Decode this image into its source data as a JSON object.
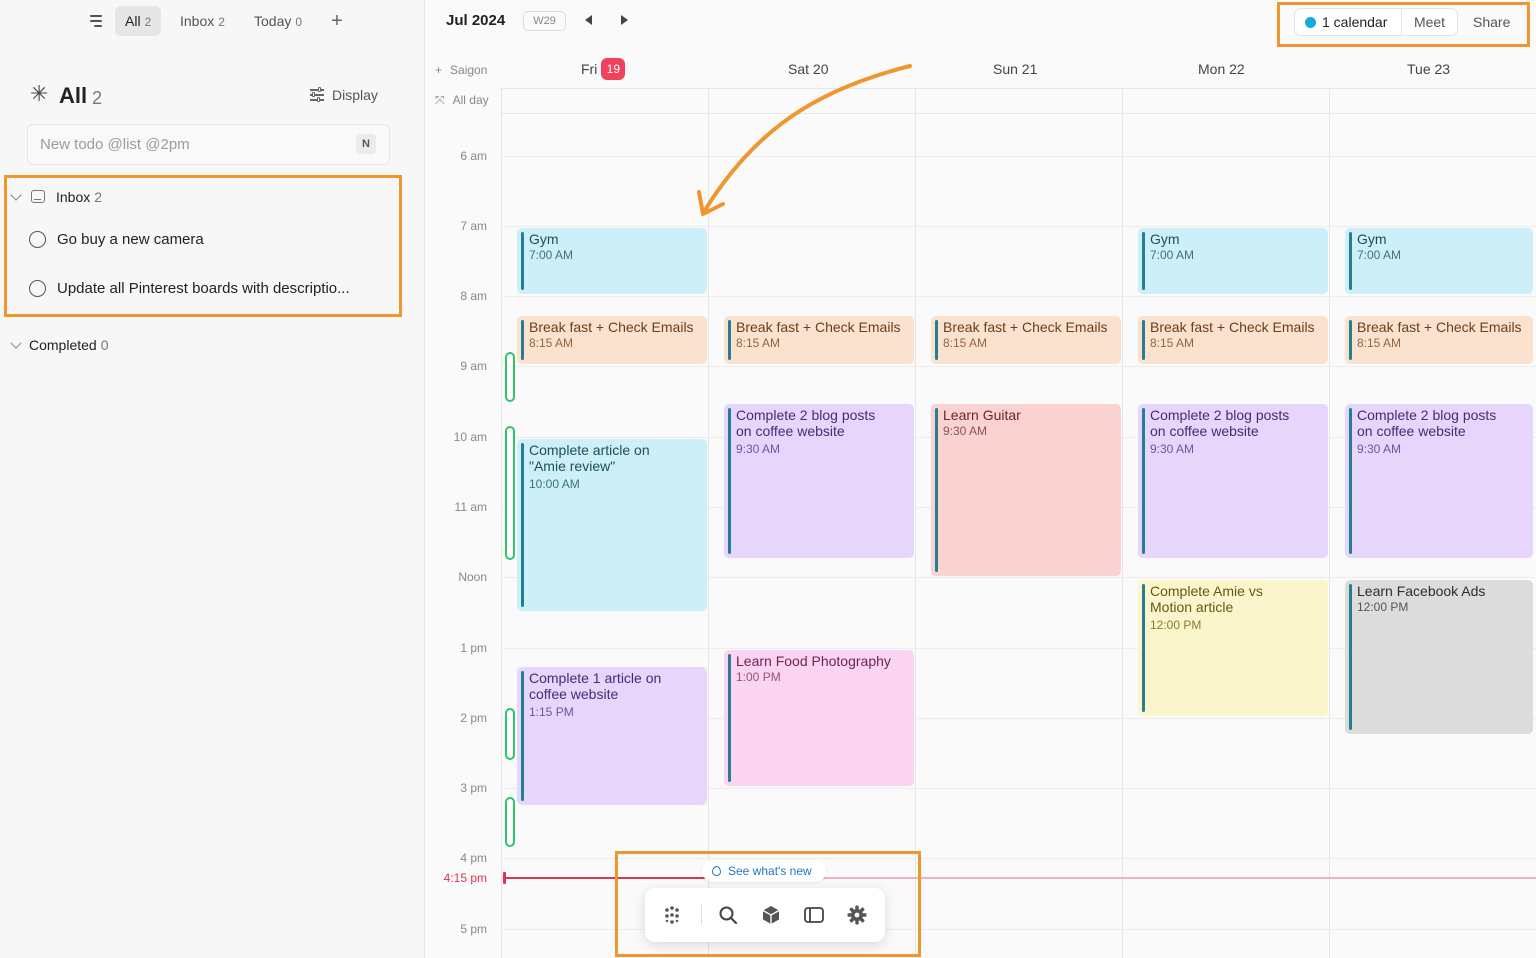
{
  "sidebar": {
    "tabs": [
      {
        "label": "All",
        "count": "2"
      },
      {
        "label": "Inbox",
        "count": "2"
      },
      {
        "label": "Today",
        "count": "0"
      }
    ],
    "title": "All",
    "title_count": "2",
    "display_label": "Display",
    "new_todo_placeholder": "New todo @list @2pm",
    "shortcut_key": "N",
    "inbox": {
      "label": "Inbox",
      "count": "2",
      "items": [
        "Go buy a new camera",
        "Update all Pinterest boards with descriptio..."
      ]
    },
    "completed": {
      "label": "Completed",
      "count": "0"
    }
  },
  "calendar": {
    "month": "Jul 2024",
    "week": "W29",
    "calendars_label": "1 calendar",
    "calendar_color": "#17a9d9",
    "meet_label": "Meet",
    "share_label": "Share",
    "timezone": "Saigon",
    "allday_label": "All day",
    "days": [
      {
        "name": "Fri",
        "num": "19",
        "today": true
      },
      {
        "name": "Sat 20"
      },
      {
        "name": "Sun 21"
      },
      {
        "name": "Mon 22"
      },
      {
        "name": "Tue 23"
      }
    ],
    "times": [
      "6 am",
      "7 am",
      "8 am",
      "9 am",
      "10 am",
      "11 am",
      "Noon",
      "1 pm",
      "2 pm",
      "3 pm",
      "4 pm",
      "5 pm"
    ],
    "now_label": "4:15 pm",
    "events": {
      "fri_gym": {
        "title": "Gym",
        "time": "7:00 AM"
      },
      "fri_breakfast": {
        "title": "Break fast + Check Emails",
        "time": "8:15 AM"
      },
      "fri_article": {
        "title": "Complete article on\n\"Amie review\"",
        "time": "10:00 AM"
      },
      "fri_coffee": {
        "title": "Complete 1 article on\ncoffee website",
        "time": "1:15 PM"
      },
      "sat_breakfast": {
        "title": "Break fast + Check Emails",
        "time": "8:15 AM"
      },
      "sat_blog": {
        "title": "Complete 2 blog posts\non coffee website",
        "time": "9:30 AM"
      },
      "sat_food": {
        "title": "Learn Food Photography",
        "time": "1:00 PM"
      },
      "sun_breakfast": {
        "title": "Break fast + Check Emails",
        "time": "8:15 AM"
      },
      "sun_guitar": {
        "title": "Learn Guitar",
        "time": "9:30 AM"
      },
      "mon_gym": {
        "title": "Gym",
        "time": "7:00 AM"
      },
      "mon_breakfast": {
        "title": "Break fast + Check Emails",
        "time": "8:15 AM"
      },
      "mon_blog": {
        "title": "Complete 2 blog posts\non coffee website",
        "time": "9:30 AM"
      },
      "mon_amie": {
        "title": "Complete Amie vs\nMotion article",
        "time": "12:00 PM"
      },
      "tue_gym": {
        "title": "Gym",
        "time": "7:00 AM"
      },
      "tue_breakfast": {
        "title": "Break fast + Check Emails",
        "time": "8:15 AM"
      },
      "tue_blog": {
        "title": "Complete 2 blog posts\non coffee website",
        "time": "9:30 AM"
      },
      "tue_fb": {
        "title": "Learn Facebook Ads",
        "time": "12:00 PM"
      }
    }
  },
  "whats_new_label": "See what's new",
  "dock_icons": [
    "apps-icon",
    "search-icon",
    "cube-icon",
    "sidebar-toggle-icon",
    "gear-icon"
  ],
  "colors": {
    "accent_highlight": "#f0962e",
    "today_badge": "#f0425a",
    "now_line": "#e03354",
    "task_pill": "#2fc56a"
  }
}
